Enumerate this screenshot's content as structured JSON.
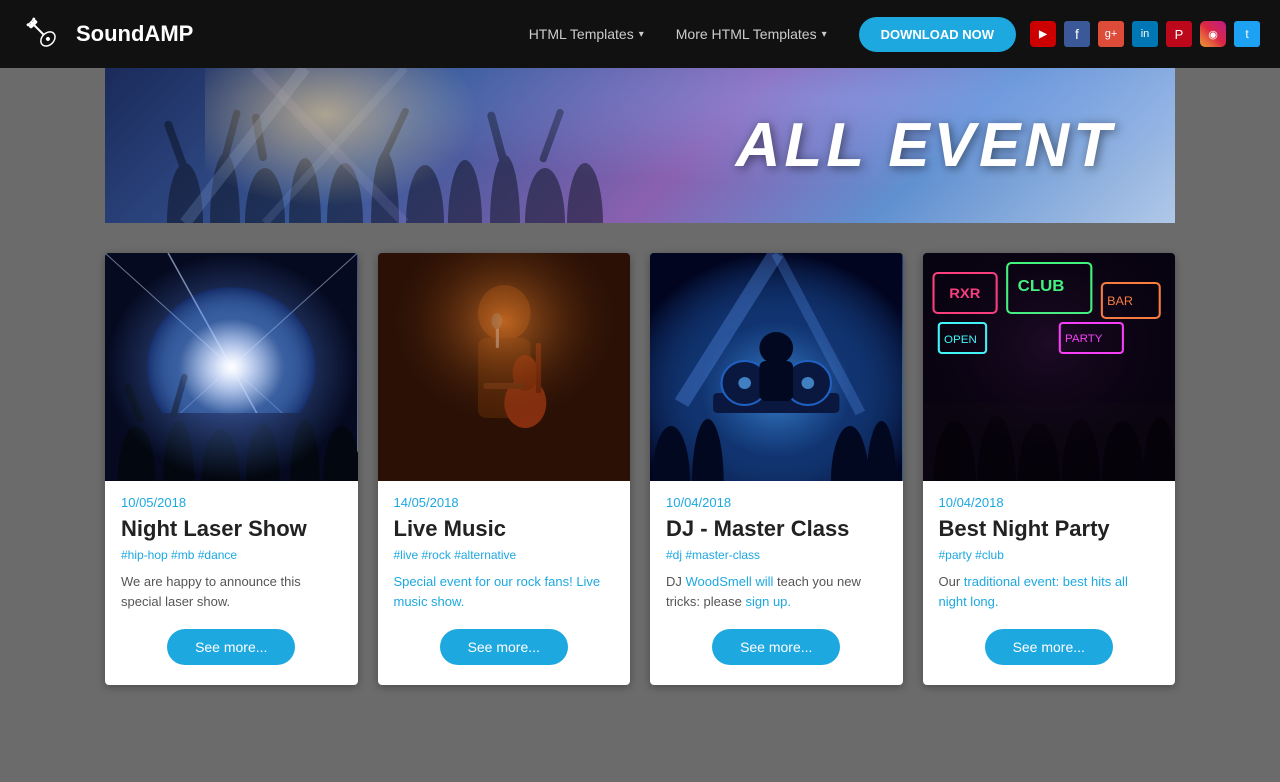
{
  "brand": {
    "name": "SoundAMP"
  },
  "nav": {
    "links": [
      {
        "label": "HTML Templates",
        "has_dropdown": true
      },
      {
        "label": "More HTML Templates",
        "has_dropdown": true
      }
    ],
    "cta_label": "DOWNLOAD NOW",
    "social": [
      {
        "name": "youtube",
        "symbol": "▶"
      },
      {
        "name": "facebook",
        "symbol": "f"
      },
      {
        "name": "google-plus",
        "symbol": "g+"
      },
      {
        "name": "linkedin",
        "symbol": "in"
      },
      {
        "name": "pinterest",
        "symbol": "P"
      },
      {
        "name": "instagram",
        "symbol": "◉"
      },
      {
        "name": "twitter",
        "symbol": "t"
      }
    ]
  },
  "hero": {
    "title": "ALL EVENT"
  },
  "cards": [
    {
      "date": "10/05/2018",
      "title": "Night Laser Show",
      "tags": "#hip-hop #mb #dance",
      "description": "We are happy to announce this special laser show.",
      "button": "See more..."
    },
    {
      "date": "14/05/2018",
      "title": "Live Music",
      "tags": "#live #rock #alternative",
      "description": "Special event for our rock fans! Live music show.",
      "button": "See more..."
    },
    {
      "date": "10/04/2018",
      "title": "DJ - Master Class",
      "tags": "#dj #master-class",
      "description": "DJ WoodSmell will teach you new tricks: please sign up.",
      "button": "See more..."
    },
    {
      "date": "10/04/2018",
      "title": "Best Night Party",
      "tags": "#party #club",
      "description": "Our traditional event: best hits all night long.",
      "button": "See more..."
    }
  ]
}
